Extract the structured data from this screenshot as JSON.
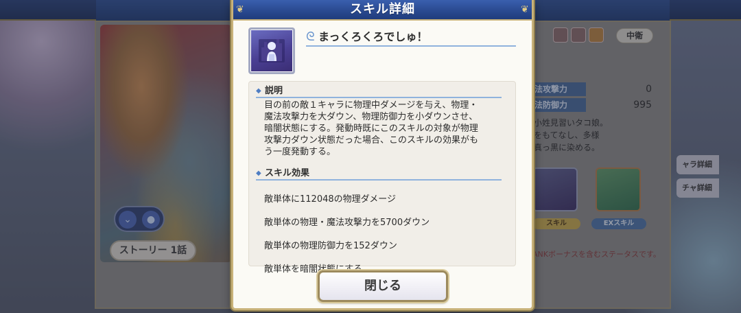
{
  "background": {
    "story_button": "ストーリー 1話",
    "position_badge": "中衛",
    "stats": [
      {
        "label": "法攻撃力",
        "value": "0"
      },
      {
        "label": "法防御力",
        "value": "995"
      }
    ],
    "profile_lines": [
      "小姓見習いタコ娘。",
      "をもてなし、多様",
      "真っ黒に染める。"
    ],
    "skill_chip": "スキル",
    "ex_skill_chip": "EXスキル",
    "rank_note": "ANKボーナスを含むステータスです。",
    "side_buttons": [
      "ャラ詳細",
      "チャ詳細"
    ]
  },
  "modal": {
    "title": "スキル詳細",
    "skill_name": "まっくろくろでしゅ！",
    "description_heading": "説明",
    "description": "目の前の敵１キャラに物理中ダメージを与え、物理・\n魔法攻撃力を大ダウン、物理防御力を小ダウンさせ、\n暗闇状態にする。発動時既にこのスキルの対象が物理\n攻撃力ダウン状態だった場合、このスキルの効果がも\nう一度発動する。",
    "effects_heading": "スキル効果",
    "effects": [
      "敵単体に112048の物理ダメージ",
      "敵単体の物理・魔法攻撃力を5700ダウン",
      "敵単体の物理防御力を152ダウン",
      "敵単体を暗闇状態にする"
    ],
    "close_label": "閉じる"
  },
  "colors": {
    "header_blue": "#2a4a91",
    "gold_border": "#c8b27a",
    "accent_line": "#8fb2dd"
  }
}
